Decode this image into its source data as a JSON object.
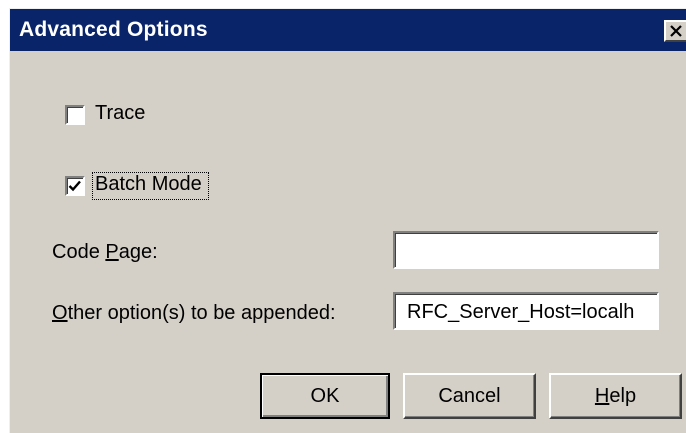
{
  "window": {
    "title": "Advanced Options",
    "close_icon": "close-icon"
  },
  "options": {
    "trace": {
      "label": "Trace",
      "checked": false
    },
    "batch_mode": {
      "label": "Batch Mode",
      "checked": true
    }
  },
  "fields": {
    "code_page": {
      "label_prefix": "Code ",
      "label_mnemonic": "P",
      "label_suffix": "age:",
      "value": ""
    },
    "other_options": {
      "label_mnemonic": "O",
      "label_suffix": "ther option(s) to be appended:",
      "value": "RFC_Server_Host=localh"
    }
  },
  "buttons": {
    "ok": "OK",
    "cancel": "Cancel",
    "help_mnemonic": "H",
    "help_suffix": "elp"
  },
  "colors": {
    "titlebar": "#0a246a",
    "dialog_bg": "#d4d0c8"
  }
}
